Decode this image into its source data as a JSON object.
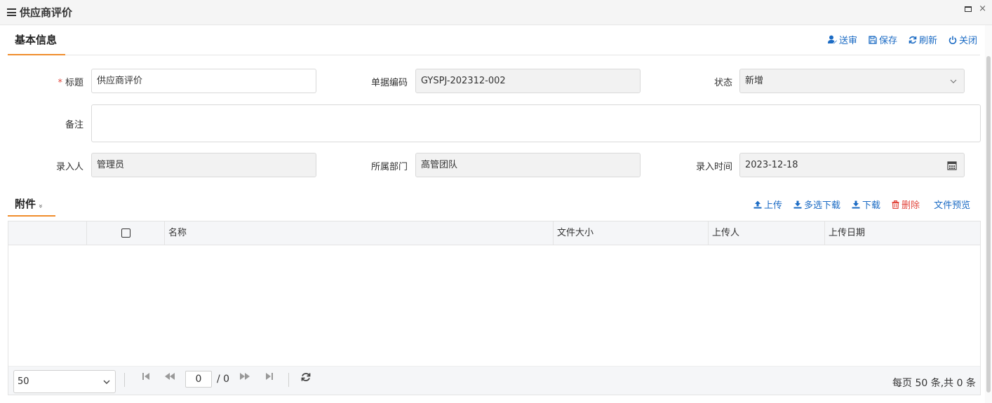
{
  "window": {
    "title": "供应商评价",
    "menu_icon": "hamburger-icon",
    "maximize_icon": "maximize-icon",
    "close_glyph": "×"
  },
  "basic_section": {
    "tab_label": "基本信息",
    "toolbar": {
      "submit": {
        "label": "送审",
        "icon": "user-send-icon"
      },
      "save": {
        "label": "保存",
        "icon": "floppy-disk-icon"
      },
      "refresh": {
        "label": "刷新",
        "icon": "refresh-icon"
      },
      "close": {
        "label": "关闭",
        "icon": "power-icon"
      }
    },
    "fields": {
      "title": {
        "label": "标题",
        "required_mark": "*",
        "value": "供应商评价"
      },
      "doc_code": {
        "label": "单据编码",
        "value": "GYSPJ-202312-002"
      },
      "status": {
        "label": "状态",
        "value": "新增",
        "icon": "chevron-down-icon"
      },
      "remark": {
        "label": "备注",
        "value": ""
      },
      "creator": {
        "label": "录入人",
        "value": "管理员"
      },
      "department": {
        "label": "所属部门",
        "value": "高管团队"
      },
      "entry_time": {
        "label": "录入时间",
        "value": "2023-12-18",
        "icon": "calendar-icon"
      }
    }
  },
  "attachment_section": {
    "tab_label": "附件",
    "collapse_glyph": "»",
    "toolbar": {
      "upload": {
        "label": "上传",
        "icon": "upload-icon"
      },
      "multi_download": {
        "label": "多选下载",
        "icon": "download-icon"
      },
      "download": {
        "label": "下载",
        "icon": "download-icon"
      },
      "delete": {
        "label": "删除",
        "icon": "trash-icon"
      },
      "preview": {
        "label": "文件预览"
      }
    },
    "grid": {
      "columns": [
        "名称",
        "文件大小",
        "上传人",
        "上传日期"
      ],
      "rows": []
    },
    "pager": {
      "page_size": "50",
      "current_page": "0",
      "total_pages": "/ 0",
      "summary": "每页 50 条,共 0 条",
      "icons": [
        "first-page-icon",
        "prev-page-icon",
        "next-page-icon",
        "last-page-icon",
        "reload-icon"
      ]
    }
  },
  "colors": {
    "accent": "#f08d2c",
    "link": "#1b6bc4",
    "danger": "#e2483e",
    "readonly_bg": "#f2f2f2"
  }
}
